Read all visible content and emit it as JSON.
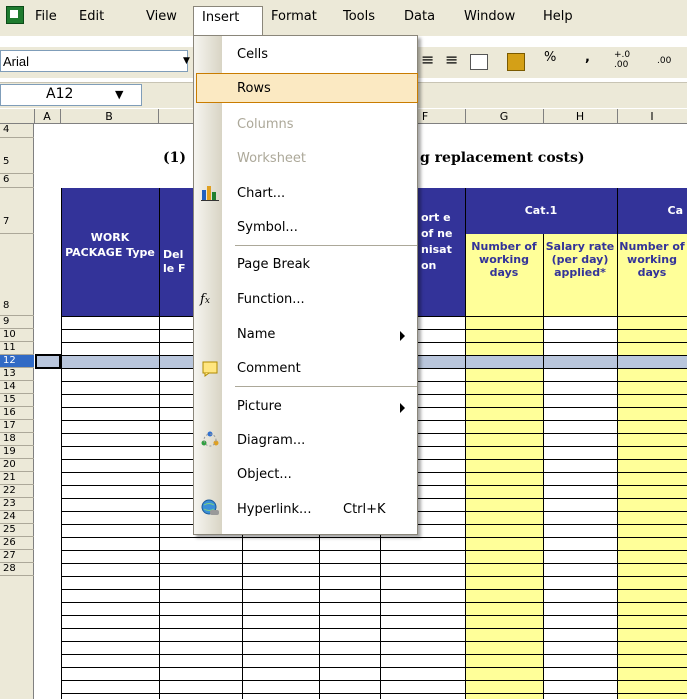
{
  "menubar": {
    "items": [
      "File",
      "Edit",
      "View",
      "Insert",
      "Format",
      "Tools",
      "Data",
      "Window",
      "Help"
    ]
  },
  "toolbar": {
    "font_name": "Arial",
    "percent": "%",
    "comma": ",",
    "inc_decimal": "+.0 .00",
    "dec_decimal": ".00"
  },
  "namebox": {
    "value": "A12"
  },
  "columns": [
    "A",
    "B",
    "F",
    "G",
    "H",
    "I"
  ],
  "rows": [
    "4",
    "5",
    "6",
    "7",
    "8",
    "9",
    "10",
    "11",
    "12",
    "13",
    "14",
    "15",
    "16",
    "17",
    "18",
    "19",
    "20",
    "21",
    "22",
    "23",
    "24",
    "25",
    "26",
    "27",
    "28"
  ],
  "sheet": {
    "title_left": "(1)",
    "title_right": "g replacement costs)",
    "work_package": "WORK PACKAGE Type",
    "del_frag": "Del le F",
    "ort_frag": "ort e of ne nisat on",
    "cat1": "Cat.1",
    "cat_next": "Ca",
    "num_working_days": "Number of working days",
    "salary_rate": "Salary rate (per day) applied*",
    "num_working_days2": "Number of working days"
  },
  "insert_menu": {
    "cells": "Cells",
    "rows": "Rows",
    "columns": "Columns",
    "worksheet": "Worksheet",
    "chart": "Chart...",
    "symbol": "Symbol...",
    "page_break": "Page Break",
    "function": "Function...",
    "name": "Name",
    "comment": "Comment",
    "picture": "Picture",
    "diagram": "Diagram...",
    "object": "Object...",
    "hyperlink": "Hyperlink...",
    "hyperlink_shortcut": "Ctrl+K"
  },
  "colors": {
    "header_blue": "#333399",
    "yellow_fill": "#ffff99",
    "menu_highlight": "#fbe9c2",
    "chrome": "#ece9d8"
  }
}
